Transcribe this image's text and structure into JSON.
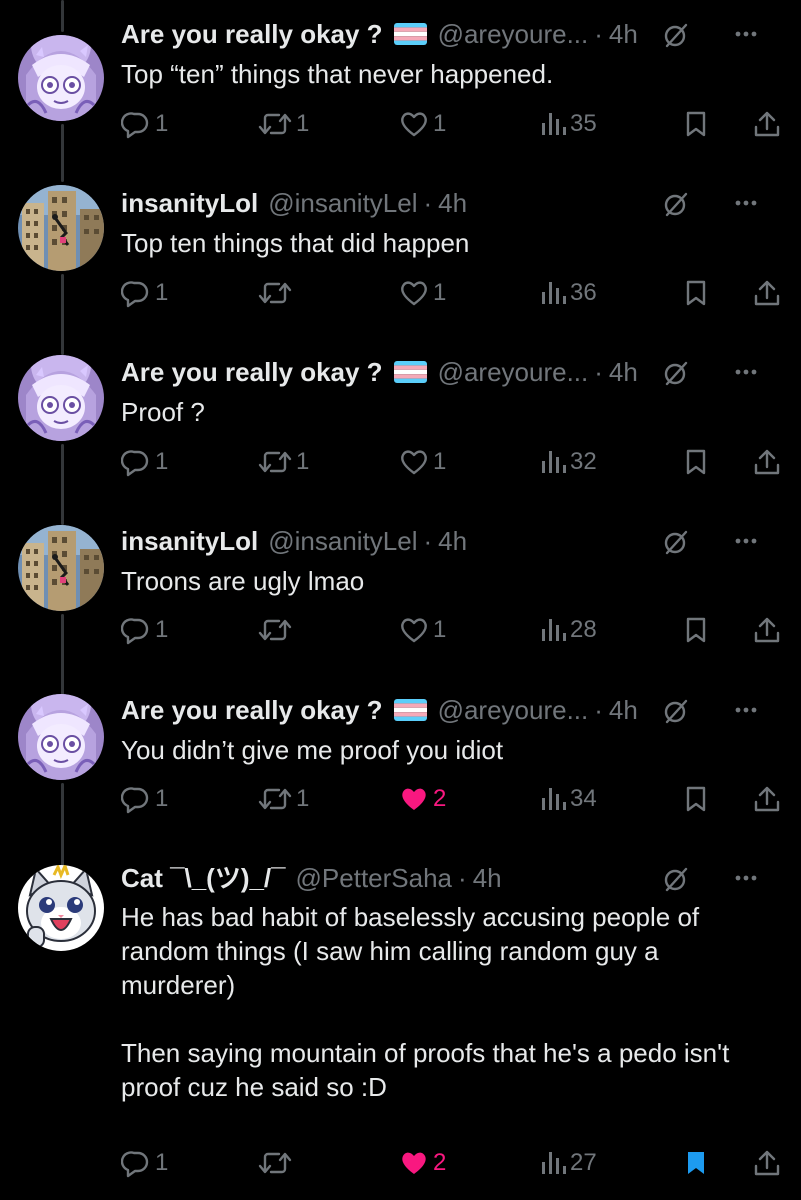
{
  "colors": {
    "background": "#000000",
    "text_primary": "#e7e9ea",
    "text_secondary": "#71767b",
    "like_active": "#f91880",
    "bookmark_active": "#1d9bf0",
    "thread_line": "#333639"
  },
  "tweets": [
    {
      "name": "Are you really okay ?",
      "has_flag": true,
      "flag_icon": "trans-flag-emoji",
      "handle": "@areyoure...",
      "dot": "·",
      "time": "4h",
      "text": [
        "Top “ten” things that never happened."
      ],
      "avatar_icon": "anime-girl-avatar",
      "replies": "1",
      "retweets": "1",
      "likes": "1",
      "liked": false,
      "views": "35",
      "bookmarked": false
    },
    {
      "name": "insanityLol",
      "has_flag": false,
      "handle": "@insanityLel",
      "dot": "·",
      "time": "4h",
      "text": [
        "Top ten things that did happen"
      ],
      "avatar_icon": "skyscraper-avatar",
      "replies": "1",
      "retweets": "",
      "likes": "1",
      "liked": false,
      "views": "36",
      "bookmarked": false
    },
    {
      "name": "Are you really okay ?",
      "has_flag": true,
      "flag_icon": "trans-flag-emoji",
      "handle": "@areyoure...",
      "dot": "·",
      "time": "4h",
      "text": [
        "Proof ?"
      ],
      "avatar_icon": "anime-girl-avatar",
      "replies": "1",
      "retweets": "1",
      "likes": "1",
      "liked": false,
      "views": "32",
      "bookmarked": false
    },
    {
      "name": "insanityLol",
      "has_flag": false,
      "handle": "@insanityLel",
      "dot": "·",
      "time": "4h",
      "text": [
        "Troons are ugly lmao"
      ],
      "avatar_icon": "skyscraper-avatar",
      "replies": "1",
      "retweets": "",
      "likes": "1",
      "liked": false,
      "views": "28",
      "bookmarked": false
    },
    {
      "name": "Are you really okay ?",
      "has_flag": true,
      "flag_icon": "trans-flag-emoji",
      "handle": "@areyoure...",
      "dot": "·",
      "time": "4h",
      "text": [
        "You didn’t give me proof you idiot"
      ],
      "avatar_icon": "anime-girl-avatar",
      "replies": "1",
      "retweets": "1",
      "likes": "2",
      "liked": true,
      "views": "34",
      "bookmarked": false
    },
    {
      "name": "Cat ¯\\_(ツ)_/¯",
      "has_flag": false,
      "handle": "@PetterSaha",
      "dot": "·",
      "time": "4h",
      "text": [
        "He has bad habit of baselessly accusing people of random things (I saw him calling random guy a murderer)",
        "Then saying mountain of proofs that he's a pedo isn't proof cuz he said so :D"
      ],
      "avatar_icon": "cartoon-cat-avatar",
      "replies": "1",
      "retweets": "",
      "likes": "2",
      "liked": true,
      "views": "27",
      "bookmarked": true
    }
  ]
}
